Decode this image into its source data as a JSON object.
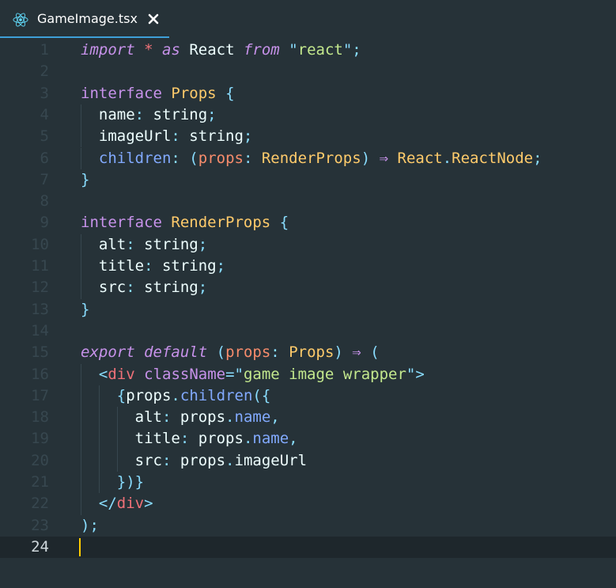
{
  "tab": {
    "icon": "react-icon",
    "title": "GameImage.tsx",
    "close_icon": "close-icon"
  },
  "editor": {
    "cursor_line": 24,
    "lines": [
      {
        "n": "1",
        "tokens": [
          [
            "kw-italic",
            "import"
          ],
          [
            "plain",
            " "
          ],
          [
            "star",
            "*"
          ],
          [
            "plain",
            " "
          ],
          [
            "kw-italic",
            "as"
          ],
          [
            "plain",
            " React "
          ],
          [
            "kw-italic",
            "from"
          ],
          [
            "plain",
            " "
          ],
          [
            "punct",
            "\""
          ],
          [
            "str",
            "react"
          ],
          [
            "punct",
            "\""
          ],
          [
            "punct",
            ";"
          ]
        ]
      },
      {
        "n": "2",
        "tokens": []
      },
      {
        "n": "3",
        "tokens": [
          [
            "kw",
            "interface"
          ],
          [
            "plain",
            " "
          ],
          [
            "type",
            "Props"
          ],
          [
            "plain",
            " "
          ],
          [
            "punct",
            "{"
          ]
        ]
      },
      {
        "n": "4",
        "tokens": [
          [
            "plain",
            "  name"
          ],
          [
            "punct",
            ":"
          ],
          [
            "plain",
            " string"
          ],
          [
            "punct",
            ";"
          ]
        ]
      },
      {
        "n": "5",
        "tokens": [
          [
            "plain",
            "  imageUrl"
          ],
          [
            "punct",
            ":"
          ],
          [
            "plain",
            " string"
          ],
          [
            "punct",
            ";"
          ]
        ]
      },
      {
        "n": "6",
        "tokens": [
          [
            "prop",
            "  children"
          ],
          [
            "punct",
            ":"
          ],
          [
            "plain",
            " "
          ],
          [
            "punct",
            "("
          ],
          [
            "param",
            "props"
          ],
          [
            "punct",
            ":"
          ],
          [
            "plain",
            " "
          ],
          [
            "type",
            "RenderProps"
          ],
          [
            "punct",
            ")"
          ],
          [
            "plain",
            " "
          ],
          [
            "kw",
            "⇒"
          ],
          [
            "plain",
            " "
          ],
          [
            "type",
            "React"
          ],
          [
            "punct",
            "."
          ],
          [
            "type",
            "ReactNode"
          ],
          [
            "punct",
            ";"
          ]
        ]
      },
      {
        "n": "7",
        "tokens": [
          [
            "punct",
            "}"
          ]
        ]
      },
      {
        "n": "8",
        "tokens": []
      },
      {
        "n": "9",
        "tokens": [
          [
            "kw",
            "interface"
          ],
          [
            "plain",
            " "
          ],
          [
            "type",
            "RenderProps"
          ],
          [
            "plain",
            " "
          ],
          [
            "punct",
            "{"
          ]
        ]
      },
      {
        "n": "10",
        "tokens": [
          [
            "plain",
            "  alt"
          ],
          [
            "punct",
            ":"
          ],
          [
            "plain",
            " string"
          ],
          [
            "punct",
            ";"
          ]
        ]
      },
      {
        "n": "11",
        "tokens": [
          [
            "plain",
            "  title"
          ],
          [
            "punct",
            ":"
          ],
          [
            "plain",
            " string"
          ],
          [
            "punct",
            ";"
          ]
        ]
      },
      {
        "n": "12",
        "tokens": [
          [
            "plain",
            "  src"
          ],
          [
            "punct",
            ":"
          ],
          [
            "plain",
            " string"
          ],
          [
            "punct",
            ";"
          ]
        ]
      },
      {
        "n": "13",
        "tokens": [
          [
            "punct",
            "}"
          ]
        ]
      },
      {
        "n": "14",
        "tokens": []
      },
      {
        "n": "15",
        "tokens": [
          [
            "kw-italic",
            "export"
          ],
          [
            "plain",
            " "
          ],
          [
            "kw-italic",
            "default"
          ],
          [
            "plain",
            " "
          ],
          [
            "punct",
            "("
          ],
          [
            "param",
            "props"
          ],
          [
            "punct",
            ":"
          ],
          [
            "plain",
            " "
          ],
          [
            "type",
            "Props"
          ],
          [
            "punct",
            ")"
          ],
          [
            "plain",
            " "
          ],
          [
            "kw",
            "⇒"
          ],
          [
            "plain",
            " "
          ],
          [
            "punct",
            "("
          ]
        ]
      },
      {
        "n": "16",
        "tokens": [
          [
            "plain",
            "  "
          ],
          [
            "punct",
            "<"
          ],
          [
            "tag",
            "div"
          ],
          [
            "plain",
            " "
          ],
          [
            "attr",
            "className"
          ],
          [
            "punct",
            "="
          ],
          [
            "punct",
            "\""
          ],
          [
            "str",
            "game image wrapper"
          ],
          [
            "punct",
            "\""
          ],
          [
            "punct",
            ">"
          ]
        ]
      },
      {
        "n": "17",
        "tokens": [
          [
            "plain",
            "    "
          ],
          [
            "punct",
            "{"
          ],
          [
            "plain",
            "props"
          ],
          [
            "punct",
            "."
          ],
          [
            "prop",
            "children"
          ],
          [
            "punct",
            "("
          ],
          [
            "punct",
            "{"
          ]
        ]
      },
      {
        "n": "18",
        "tokens": [
          [
            "plain",
            "      alt"
          ],
          [
            "punct",
            ":"
          ],
          [
            "plain",
            " props"
          ],
          [
            "punct",
            "."
          ],
          [
            "prop",
            "name"
          ],
          [
            "punct",
            ","
          ]
        ]
      },
      {
        "n": "19",
        "tokens": [
          [
            "plain",
            "      title"
          ],
          [
            "punct",
            ":"
          ],
          [
            "plain",
            " props"
          ],
          [
            "punct",
            "."
          ],
          [
            "prop",
            "name"
          ],
          [
            "punct",
            ","
          ]
        ]
      },
      {
        "n": "20",
        "tokens": [
          [
            "plain",
            "      src"
          ],
          [
            "punct",
            ":"
          ],
          [
            "plain",
            " props"
          ],
          [
            "punct",
            "."
          ],
          [
            "plain",
            "imageUrl"
          ]
        ]
      },
      {
        "n": "21",
        "tokens": [
          [
            "plain",
            "    "
          ],
          [
            "punct",
            "})}"
          ]
        ]
      },
      {
        "n": "22",
        "tokens": [
          [
            "plain",
            "  "
          ],
          [
            "punct",
            "</"
          ],
          [
            "tag",
            "div"
          ],
          [
            "punct",
            ">"
          ]
        ]
      },
      {
        "n": "23",
        "tokens": [
          [
            "punct",
            ")"
          ],
          [
            "punct",
            ";"
          ]
        ]
      },
      {
        "n": "24",
        "tokens": []
      }
    ]
  }
}
